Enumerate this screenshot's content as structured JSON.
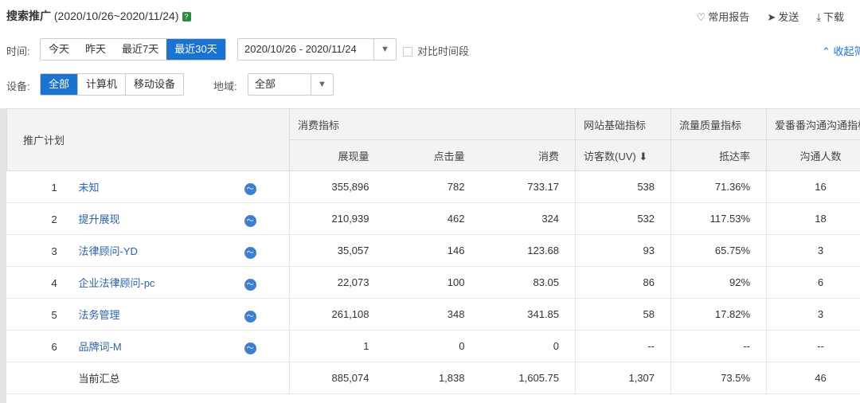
{
  "header": {
    "title": "搜索推广",
    "range": "(2020/10/26~2020/11/24)",
    "help": "?"
  },
  "toplinks": [
    {
      "icon": "heart-icon",
      "glyph": "♡",
      "label": "常用报告"
    },
    {
      "icon": "send-icon",
      "glyph": "➤",
      "label": "发送"
    },
    {
      "icon": "download-icon",
      "glyph": "⤓",
      "label": "下载"
    }
  ],
  "filters": {
    "time_label": "时间:",
    "time_options": [
      "今天",
      "昨天",
      "最近7天",
      "最近30天"
    ],
    "time_selected": "最近30天",
    "date_range": "2020/10/26 - 2020/11/24",
    "compare_label": "对比时间段",
    "device_label": "设备:",
    "device_options": [
      "全部",
      "计算机",
      "移动设备"
    ],
    "device_selected": "全部",
    "region_label": "地域:",
    "region_value": "全部",
    "collapse": "收起筛"
  },
  "table": {
    "plan_header": "推广计划",
    "groups": [
      "消费指标",
      "网站基础指标",
      "流量质量指标",
      "爱番番沟通沟通指标"
    ],
    "columns": [
      "展现量",
      "点击量",
      "消费",
      "访客数(UV)",
      "抵达率",
      "沟通人数"
    ],
    "rows": [
      {
        "idx": "1",
        "name": "未知",
        "v": [
          "355,896",
          "782",
          "733.17",
          "538",
          "71.36%",
          "16"
        ]
      },
      {
        "idx": "2",
        "name": "提升展现",
        "v": [
          "210,939",
          "462",
          "324",
          "532",
          "117.53%",
          "18"
        ]
      },
      {
        "idx": "3",
        "name": "法律顾问-YD",
        "v": [
          "35,057",
          "146",
          "123.68",
          "93",
          "65.75%",
          "3"
        ]
      },
      {
        "idx": "4",
        "name": "企业法律顾问-pc",
        "v": [
          "22,073",
          "100",
          "83.05",
          "86",
          "92%",
          "6"
        ]
      },
      {
        "idx": "5",
        "name": "法务管理",
        "v": [
          "261,108",
          "348",
          "341.85",
          "58",
          "17.82%",
          "3"
        ]
      },
      {
        "idx": "6",
        "name": "品牌词-M",
        "v": [
          "1",
          "0",
          "0",
          "--",
          "--",
          "--"
        ]
      }
    ],
    "total": {
      "label": "当前汇总",
      "v": [
        "885,074",
        "1,838",
        "1,605.75",
        "1,307",
        "73.5%",
        "46"
      ]
    }
  }
}
